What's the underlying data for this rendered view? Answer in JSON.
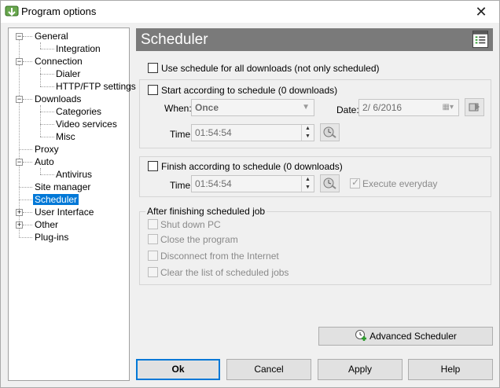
{
  "window": {
    "title": "Program options",
    "close_glyph": "✕"
  },
  "tree": {
    "items": [
      {
        "label": "General"
      },
      {
        "label": "Integration"
      },
      {
        "label": "Connection"
      },
      {
        "label": "Dialer"
      },
      {
        "label": "HTTP/FTP settings"
      },
      {
        "label": "Downloads"
      },
      {
        "label": "Categories"
      },
      {
        "label": "Video services"
      },
      {
        "label": "Misc"
      },
      {
        "label": "Proxy"
      },
      {
        "label": "Auto"
      },
      {
        "label": "Antivirus"
      },
      {
        "label": "Site manager"
      },
      {
        "label": "Scheduler"
      },
      {
        "label": "User Interface"
      },
      {
        "label": "Other"
      },
      {
        "label": "Plug-ins"
      }
    ]
  },
  "header": {
    "title": "Scheduler"
  },
  "options": {
    "use_schedule_all": "Use schedule for all downloads (not only scheduled)",
    "start": {
      "label": "Start according to schedule  (0 downloads)",
      "when_label": "When:",
      "when_value": "Once",
      "date_label": "Date:",
      "date_value": "2/  6/2016",
      "time_label": "Time:",
      "time_value": "01:54:54"
    },
    "finish": {
      "label": "Finish according to schedule  (0 downloads)",
      "time_label": "Time:",
      "time_value": "01:54:54",
      "execute_everyday": "Execute everyday"
    },
    "after": {
      "title": "After finishing scheduled job",
      "items": [
        "Shut down PC",
        "Close the program",
        "Disconnect from the Internet",
        "Clear the list of scheduled jobs"
      ]
    }
  },
  "buttons": {
    "advanced": "Advanced Scheduler",
    "ok": "Ok",
    "cancel": "Cancel",
    "apply": "Apply",
    "help": "Help"
  },
  "colors": {
    "selection": "#0078d7",
    "header_bg": "#7a7a7a",
    "accent_green": "#2e9a2e"
  }
}
